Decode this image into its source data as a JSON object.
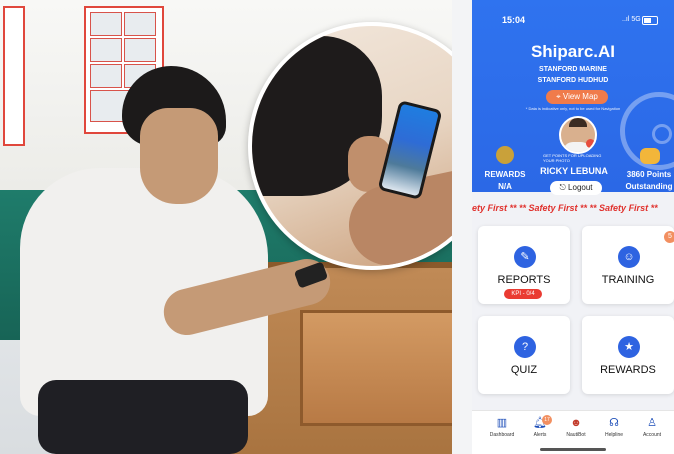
{
  "status_bar": {
    "time": "15:04",
    "network": "..ıl 5G"
  },
  "app": {
    "title": "Shiparc.AI",
    "company": "STANFORD MARINE",
    "vessel": "STANFORD HUDHUD",
    "view_map_label": "View Map",
    "disclaimer": "* Data is indicative only, not to be used for Navigation",
    "photo_hint": "GET POINTS FOR UPLOADING YOUR PHOTO",
    "user_name": "RICKY LEBUNA",
    "logout_label": "Logout",
    "rewards": {
      "label": "REWARDS",
      "value": "N/A"
    },
    "points": {
      "label": "3860 Points",
      "sub": "Outstanding"
    },
    "ticker": "ety First ** ** Safety First ** ** Safety First **"
  },
  "cards": [
    {
      "label": "REPORTS",
      "kpi": "KPI - 0/4",
      "icon": "reports-icon"
    },
    {
      "label": "TRAINING",
      "count": "5",
      "icon": "training-icon"
    },
    {
      "label": "QUIZ",
      "icon": "quiz-icon"
    },
    {
      "label": "REWARDS",
      "icon": "rewards-icon"
    }
  ],
  "bottom_nav": [
    {
      "label": "Dashboard",
      "icon": "dashboard-icon"
    },
    {
      "label": "Alerts",
      "icon": "bell-icon",
      "badge": "17"
    },
    {
      "label": "NautiBot",
      "icon": "bot-icon"
    },
    {
      "label": "Helpline",
      "icon": "headset-icon"
    },
    {
      "label": "Account",
      "icon": "user-icon"
    }
  ]
}
